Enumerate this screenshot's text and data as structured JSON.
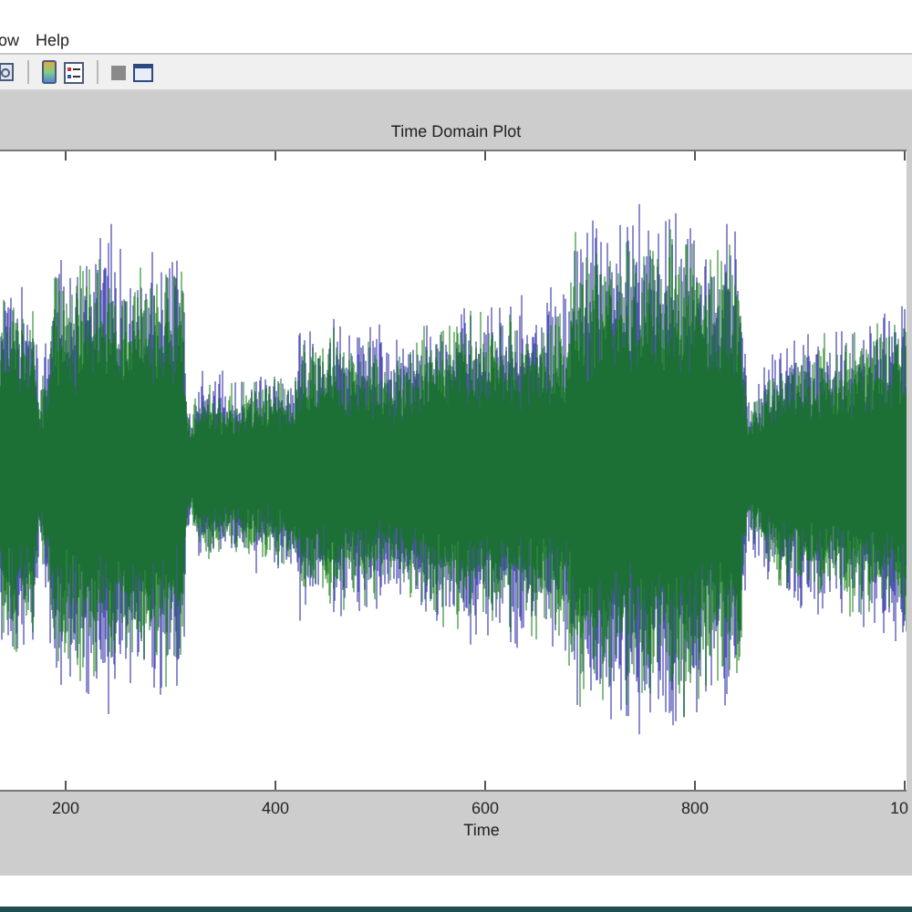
{
  "menu": [
    "ow",
    "Help"
  ],
  "plot": {
    "title": "Time Domain Plot",
    "xlabel": "Time",
    "xticks": [
      "200",
      "400",
      "600",
      "800",
      "10"
    ]
  }
}
